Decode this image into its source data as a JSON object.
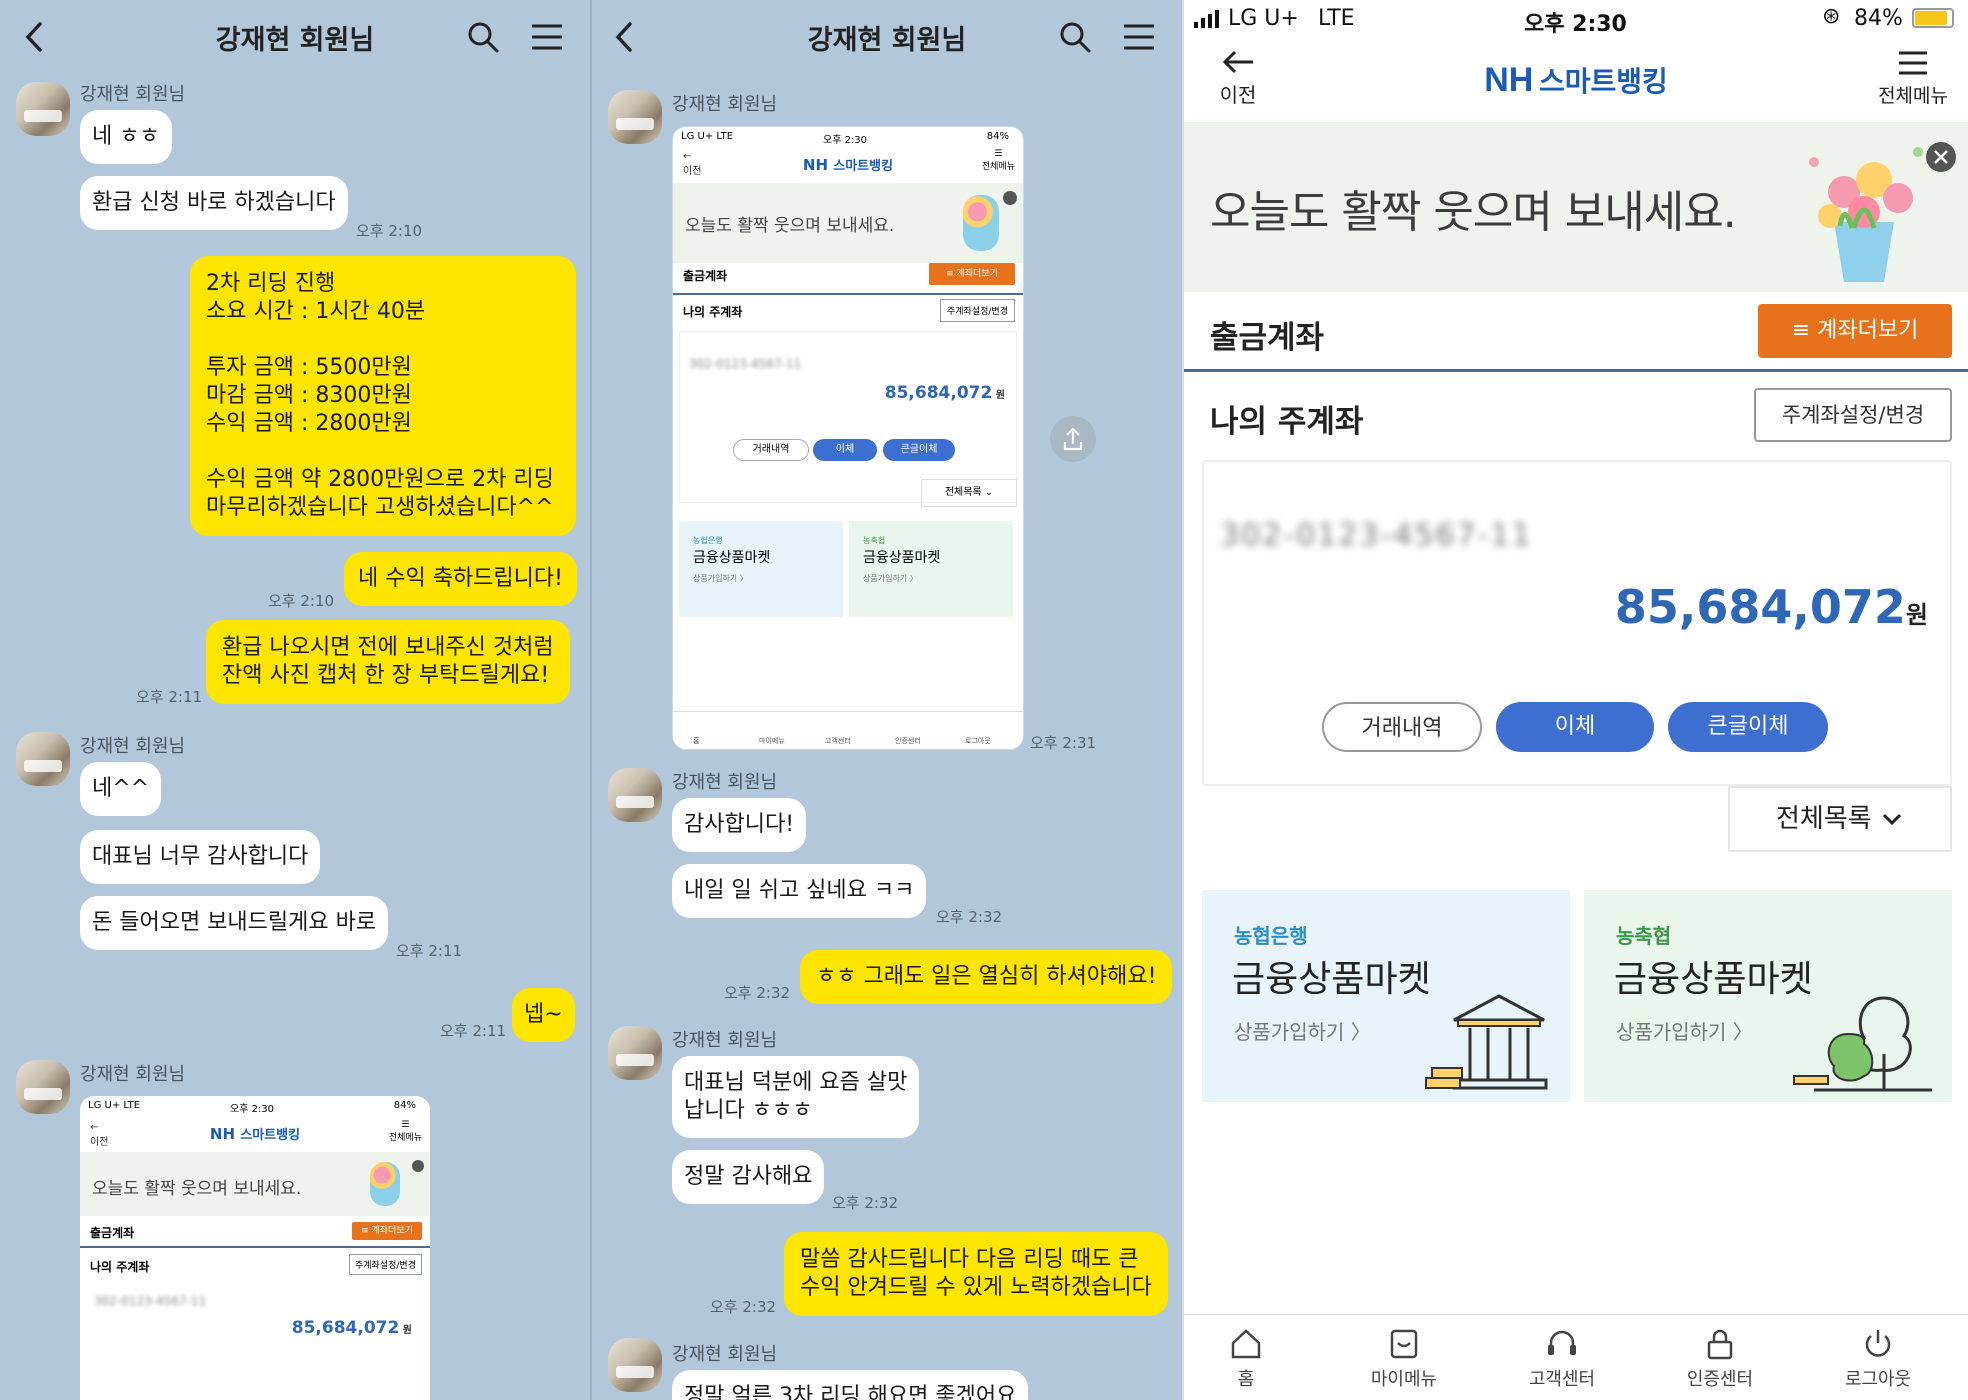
{
  "chat_left": {
    "title": "강재현 회원님",
    "messages": [
      {
        "sender": "강재현 회원님"
      },
      {
        "text": "네 ㅎㅎ"
      },
      {
        "text": "환급 신청 바로 하겠습니다",
        "time": "오후 2:10"
      },
      {
        "text": "2차 리딩 진행\n소요 시간 : 1시간 40분\n\n투자 금액 : 5500만원\n마감 금액 : 8300만원\n수익 금액 : 2800만원\n\n수익 금액 약 2800만원으로 2차 리딩\n마무리하겠습니다 고생하셨습니다^^"
      },
      {
        "text": "네 수익 축하드립니다!",
        "time": "오후 2:10"
      },
      {
        "text": "환급 나오시면 전에 보내주신 것처럼\n잔액 사진 캡처 한 장 부탁드릴게요!",
        "time": "오후 2:11"
      },
      {
        "sender": "강재현 회원님"
      },
      {
        "text": "네^^"
      },
      {
        "text": "대표님 너무 감사합니다"
      },
      {
        "text": "돈 들어오면 보내드릴게요 바로",
        "time": "오후 2:11"
      },
      {
        "text": "넵~",
        "time": "오후 2:11"
      },
      {
        "sender": "강재현 회원님"
      }
    ]
  },
  "chat_mid": {
    "title": "강재현 회원님",
    "messages": [
      {
        "sender": "강재현 회원님",
        "time": "오후 2:31"
      },
      {
        "sender": "강재현 회원님"
      },
      {
        "text": "감사합니다!"
      },
      {
        "text": "내일 일 쉬고 싶네요 ㅋㅋ",
        "time": "오후 2:32"
      },
      {
        "text": "ㅎㅎ 그래도 일은 열심히 하셔야해요!",
        "time": "오후 2:32"
      },
      {
        "sender": "강재현 회원님"
      },
      {
        "text": "대표님 덕분에 요즘 살맛\n납니다 ㅎㅎㅎ"
      },
      {
        "text": "정말 감사해요",
        "time": "오후 2:32"
      },
      {
        "text": "말씀 감사드립니다 다음 리딩 때도 큰\n수익 안겨드릴 수 있게 노력하겠습니다",
        "time": "오후 2:32"
      },
      {
        "sender": "강재현 회원님"
      },
      {
        "text": "정말 얼른 3차 리딩 해요면 좋겠어요"
      }
    ]
  },
  "bank": {
    "status": {
      "carrier": "LG U+",
      "network": "LTE",
      "time": "오후 2:30",
      "battery": "84%"
    },
    "back_label": "이전",
    "brand_nh": "NH",
    "brand_name": "스마트뱅킹",
    "menu_label": "전체메뉴",
    "banner_text": "오늘도 활짝 웃으며 보내세요.",
    "withdraw_title": "출금계좌",
    "more_accounts": "계좌더보기",
    "main_account_title": "나의 주계좌",
    "main_account_btn": "주계좌설정/변경",
    "account_number_masked": "302-0123-4567-11",
    "balance": "85,684,072",
    "currency": "원",
    "actions": [
      "거래내역",
      "이체",
      "큰글이체"
    ],
    "all_list": "전체목록",
    "cards": [
      {
        "bank": "농협은행",
        "title": "금융상품마켓",
        "link": "상품가입하기 〉"
      },
      {
        "bank": "농축협",
        "title": "금융상품마켓",
        "link": "상품가입하기 〉"
      }
    ],
    "tabs": [
      "홈",
      "마이메뉴",
      "고객센터",
      "인증센터",
      "로그아웃"
    ],
    "colors": {
      "nh_blue": "#1a5bb8",
      "orange": "#e8721c",
      "balance_blue": "#2f67b7",
      "pill_blue": "#3d6fd1"
    }
  }
}
